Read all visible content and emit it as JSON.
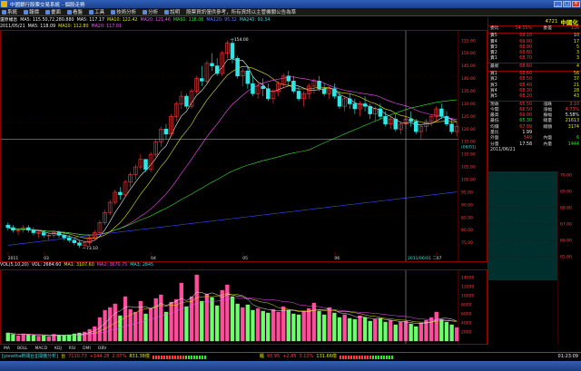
{
  "window": {
    "title": "中國銀行股票交易系統 - 個股走勢",
    "buttons": [
      "_",
      "□",
      "×"
    ]
  },
  "menu": [
    "系統",
    "報價",
    "畫面",
    "看盤",
    "工具",
    "技術分析",
    "分析",
    "說明",
    "股票資訊僅供參考，所有資訊以主管機關公告為準"
  ],
  "header": {
    "row1": [
      {
        "t": "還原權息",
        "c": "white"
      },
      {
        "t": "MA5: 115.50,72,280.880",
        "c": "white"
      },
      {
        "t": "MA5: 117.17",
        "c": "white"
      },
      {
        "t": "MA10: 122.42",
        "c": "yellow"
      },
      {
        "t": "MA20: 121.46",
        "c": "magenta"
      },
      {
        "t": "MA60: 118.06",
        "c": "green"
      },
      {
        "t": "MA120: 95.32",
        "c": "blue"
      },
      {
        "t": "MA240: 90.34",
        "c": "cyan"
      }
    ],
    "row2": [
      {
        "t": "2011/05/21",
        "c": "white"
      },
      {
        "t": "MA5: 118.09",
        "c": "white"
      },
      {
        "t": "MA10: 112.80",
        "c": "yellow"
      },
      {
        "t": "MA20: 117.01",
        "c": "magenta"
      }
    ]
  },
  "price_axis": {
    "labels": [
      "155.00",
      "150.00",
      "145.00",
      "140.00",
      "135.00",
      "130.00",
      "125.00",
      "120.00",
      "115.00",
      "110.00",
      "105.00",
      "100.00",
      "95.00",
      "90.00",
      "85.00",
      "80.00",
      "75.00"
    ],
    "high_label": "154.00",
    "low_label": "73.10",
    "crosshair_label": "(06/01)",
    "date_tag": "2011/06/01 二"
  },
  "time_axis": [
    "2011",
    "03",
    "04",
    "05",
    "06",
    "07"
  ],
  "vol_header": [
    {
      "t": "VOL(5,10,20)",
      "c": "white"
    },
    {
      "t": "VOL: 2684.60",
      "c": "white"
    },
    {
      "t": "MA1: 3107.60",
      "c": "yellow"
    },
    {
      "t": "MA2: 3670.75",
      "c": "magenta"
    },
    {
      "t": "MA3: 2845",
      "c": "cyan"
    }
  ],
  "vol_axis": [
    "14000",
    "12000",
    "10000",
    "8000",
    "6000",
    "4000",
    "2000"
  ],
  "bottom_tabs": [
    "MA",
    "BOLL",
    "MACD",
    "KDJ",
    "RSI",
    "DMI",
    "OBV"
  ],
  "info": {
    "code": "4721",
    "name": "中國化",
    "rows": [
      {
        "l": "委比",
        "v": "54.55%",
        "vc": "red",
        "l2": "委差",
        "v2": "136",
        "v2c": "red"
      },
      {
        "l": "賣5",
        "v": "69.10",
        "vc": "red",
        "l2": "",
        "v2": "10",
        "v2c": "yellow"
      },
      {
        "l": "賣4",
        "v": "69.00",
        "vc": "red",
        "l2": "",
        "v2": "17",
        "v2c": "yellow"
      },
      {
        "l": "賣3",
        "v": "68.90",
        "vc": "red",
        "l2": "",
        "v2": "5",
        "v2c": "yellow"
      },
      {
        "l": "賣2",
        "v": "68.80",
        "vc": "red",
        "l2": "",
        "v2": "3",
        "v2c": "yellow"
      },
      {
        "l": "賣1",
        "v": "68.70",
        "vc": "red",
        "l2": "",
        "v2": "3",
        "v2c": "yellow"
      },
      {
        "l": "最新",
        "v": "68.60",
        "vc": "red",
        "l2": "",
        "v2": "4",
        "v2c": "yellow"
      },
      {
        "l": "買1",
        "v": "68.60",
        "vc": "red",
        "l2": "",
        "v2": "56",
        "v2c": "yellow"
      },
      {
        "l": "買2",
        "v": "68.50",
        "vc": "red",
        "l2": "",
        "v2": "37",
        "v2c": "yellow"
      },
      {
        "l": "買3",
        "v": "68.40",
        "vc": "red",
        "l2": "",
        "v2": "21",
        "v2c": "yellow"
      },
      {
        "l": "買4",
        "v": "68.30",
        "vc": "red",
        "l2": "",
        "v2": "28",
        "v2c": "yellow"
      },
      {
        "l": "買5",
        "v": "68.20",
        "vc": "red",
        "l2": "",
        "v2": "43",
        "v2c": "yellow"
      },
      {
        "l": "現收",
        "v": "65.50",
        "vc": "red",
        "l2": "漲跌",
        "v2": "3.10",
        "v2c": "red"
      },
      {
        "l": "今開",
        "v": "66.50",
        "vc": "red",
        "l2": "漲幅",
        "v2": "4.73%",
        "v2c": "red"
      },
      {
        "l": "最高",
        "v": "69.00",
        "vc": "red",
        "l2": "振幅",
        "v2": "5.58%",
        "v2c": "white"
      },
      {
        "l": "最低",
        "v": "65.30",
        "vc": "green",
        "l2": "總量",
        "v2": "21613",
        "v2c": "yellow"
      },
      {
        "l": "均價",
        "v": "67.09",
        "vc": "red",
        "l2": "總額",
        "v2": "3174",
        "v2c": "yellow"
      },
      {
        "l": "量比",
        "v": "1.99",
        "vc": "white",
        "l2": "",
        "v2": "",
        "v2c": "white"
      },
      {
        "l": "外盤",
        "v": "549",
        "vc": "red",
        "l2": "內盤",
        "v2": "6",
        "v2c": "green"
      },
      {
        "l": "分量",
        "v": "17.58",
        "vc": "white",
        "l2": "內量",
        "v2": "1444",
        "v2c": "green"
      }
    ],
    "date": "2011/06/21"
  },
  "mini_axis": [
    "70.00",
    "69.00",
    "68.00",
    "67.00",
    "66.00",
    "65.00"
  ],
  "status": {
    "left_tag": "[yonetta新聞台][開機分析]",
    "index1_label": "台",
    "index1": "7110.73",
    "index1_chg": "+144.28",
    "index1_pct": "2.07%",
    "index1_amt": "831.38億",
    "index2_label": "櫃",
    "index2": "93.95",
    "index2_chg": "+2.85",
    "index2_pct": "3.13%",
    "index2_amt": "131.66億",
    "clock": "01:23:09"
  },
  "chart_data": {
    "type": "candlestick",
    "note": "daily candles, 2011",
    "ylim": [
      72,
      156
    ],
    "candles": [
      [
        82,
        83,
        80,
        81
      ],
      [
        81,
        82,
        79,
        80
      ],
      [
        80,
        81,
        78,
        80
      ],
      [
        80,
        82,
        79,
        81
      ],
      [
        81,
        82,
        79,
        80
      ],
      [
        80,
        81,
        78,
        79
      ],
      [
        79,
        80,
        77,
        79
      ],
      [
        79,
        80,
        77,
        78
      ],
      [
        78,
        79,
        76,
        78
      ],
      [
        78,
        80,
        77,
        79
      ],
      [
        79,
        80,
        77,
        78
      ],
      [
        78,
        79,
        76,
        77
      ],
      [
        77,
        78,
        75,
        76
      ],
      [
        76,
        77,
        74,
        75
      ],
      [
        75,
        76,
        73,
        74
      ],
      [
        74,
        76,
        73,
        75
      ],
      [
        75,
        78,
        74,
        77
      ],
      [
        77,
        80,
        76,
        79
      ],
      [
        79,
        84,
        78,
        83
      ],
      [
        83,
        88,
        82,
        87
      ],
      [
        87,
        92,
        86,
        91
      ],
      [
        91,
        96,
        90,
        95
      ],
      [
        95,
        97,
        92,
        94
      ],
      [
        94,
        100,
        93,
        99
      ],
      [
        99,
        103,
        97,
        102
      ],
      [
        102,
        106,
        100,
        105
      ],
      [
        105,
        110,
        104,
        108
      ],
      [
        108,
        107,
        103,
        104
      ],
      [
        104,
        111,
        103,
        110
      ],
      [
        110,
        116,
        109,
        115
      ],
      [
        115,
        121,
        113,
        120
      ],
      [
        120,
        122,
        116,
        118
      ],
      [
        118,
        126,
        117,
        125
      ],
      [
        125,
        131,
        123,
        130
      ],
      [
        130,
        135,
        128,
        133
      ],
      [
        133,
        134,
        128,
        129
      ],
      [
        129,
        136,
        128,
        135
      ],
      [
        135,
        141,
        134,
        140
      ],
      [
        140,
        145,
        137,
        139
      ],
      [
        139,
        147,
        138,
        146
      ],
      [
        146,
        150,
        143,
        145
      ],
      [
        145,
        148,
        141,
        142
      ],
      [
        142,
        151,
        141,
        150
      ],
      [
        150,
        155,
        148,
        154
      ],
      [
        154,
        156,
        146,
        148
      ],
      [
        148,
        149,
        140,
        141
      ],
      [
        141,
        144,
        137,
        143
      ],
      [
        143,
        145,
        136,
        138
      ],
      [
        138,
        141,
        133,
        134
      ],
      [
        134,
        139,
        132,
        137
      ],
      [
        137,
        140,
        133,
        136
      ],
      [
        136,
        138,
        131,
        132
      ],
      [
        132,
        136,
        130,
        135
      ],
      [
        135,
        139,
        133,
        138
      ],
      [
        138,
        142,
        136,
        141
      ],
      [
        141,
        143,
        137,
        139
      ],
      [
        139,
        141,
        134,
        135
      ],
      [
        135,
        137,
        131,
        132
      ],
      [
        132,
        135,
        129,
        134
      ],
      [
        134,
        138,
        132,
        137
      ],
      [
        137,
        140,
        134,
        139
      ],
      [
        139,
        141,
        135,
        136
      ],
      [
        136,
        138,
        133,
        134
      ],
      [
        134,
        137,
        132,
        136
      ],
      [
        136,
        138,
        132,
        133
      ],
      [
        133,
        135,
        128,
        129
      ],
      [
        129,
        133,
        127,
        132
      ],
      [
        132,
        134,
        128,
        130
      ],
      [
        130,
        132,
        126,
        128
      ],
      [
        128,
        131,
        125,
        130
      ],
      [
        130,
        133,
        127,
        129
      ],
      [
        129,
        130,
        124,
        126
      ],
      [
        126,
        129,
        123,
        128
      ],
      [
        128,
        130,
        124,
        125
      ],
      [
        125,
        127,
        121,
        122
      ],
      [
        122,
        125,
        120,
        124
      ],
      [
        124,
        126,
        119,
        120
      ],
      [
        120,
        123,
        118,
        122
      ],
      [
        122,
        125,
        120,
        124
      ],
      [
        124,
        127,
        121,
        123
      ],
      [
        123,
        124,
        118,
        119
      ],
      [
        119,
        122,
        116,
        121
      ],
      [
        121,
        124,
        119,
        123
      ],
      [
        123,
        126,
        121,
        125
      ],
      [
        125,
        129,
        123,
        128
      ],
      [
        128,
        130,
        124,
        125
      ],
      [
        125,
        127,
        121,
        122
      ],
      [
        122,
        124,
        118,
        119
      ],
      [
        119,
        123,
        117,
        121
      ]
    ],
    "volume": [
      1800,
      1500,
      1200,
      1600,
      1400,
      1300,
      1100,
      1200,
      1000,
      1500,
      1300,
      1200,
      1400,
      1600,
      1800,
      2000,
      2600,
      3200,
      5200,
      6800,
      7400,
      8200,
      5600,
      9800,
      7000,
      6400,
      8800,
      6000,
      7200,
      9400,
      10200,
      6400,
      8600,
      9200,
      12800,
      7600,
      9800,
      14600,
      8800,
      10400,
      9600,
      7800,
      11200,
      12400,
      9800,
      8200,
      7400,
      8000,
      6800,
      7200,
      6600,
      6200,
      7000,
      6400,
      7600,
      6800,
      6000,
      5800,
      6600,
      7200,
      8400,
      6600,
      5800,
      7400,
      6200,
      5200,
      5800,
      5000,
      4800,
      5600,
      5200,
      4400,
      4800,
      5000,
      4200,
      4600,
      3600,
      4200,
      4400,
      3800,
      3200,
      4000,
      4600,
      5200,
      6400,
      4800,
      4200,
      3600,
      3000
    ]
  }
}
